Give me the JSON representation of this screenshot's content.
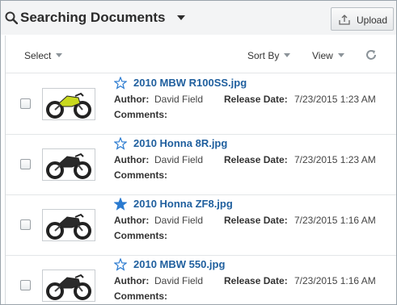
{
  "header": {
    "title": "Searching Documents",
    "upload_label": "Upload"
  },
  "toolbar": {
    "select_label": "Select",
    "sort_label": "Sort By",
    "view_label": "View"
  },
  "labels": {
    "author": "Author:",
    "release_date": "Release Date:",
    "comments": "Comments:"
  },
  "documents": [
    {
      "name": "2010 MBW R100SS.jpg",
      "author": "David Field",
      "release_date": "7/23/2015 1:23 AM",
      "favorite": false,
      "thumb_color": "#c8d81e"
    },
    {
      "name": "2010 Honna 8R.jpg",
      "author": "David Field",
      "release_date": "7/23/2015 1:23 AM",
      "favorite": false,
      "thumb_color": "#2a2a2a"
    },
    {
      "name": "2010 Honna ZF8.jpg",
      "author": "David Field",
      "release_date": "7/23/2015 1:16 AM",
      "favorite": true,
      "thumb_color": "#2a2a2a"
    },
    {
      "name": "2010 MBW 550.jpg",
      "author": "David Field",
      "release_date": "7/23/2015 1:16 AM",
      "favorite": false,
      "thumb_color": "#2a2a2a"
    }
  ],
  "colors": {
    "accent": "#1f5f9e",
    "star": "#2b7bd0"
  }
}
